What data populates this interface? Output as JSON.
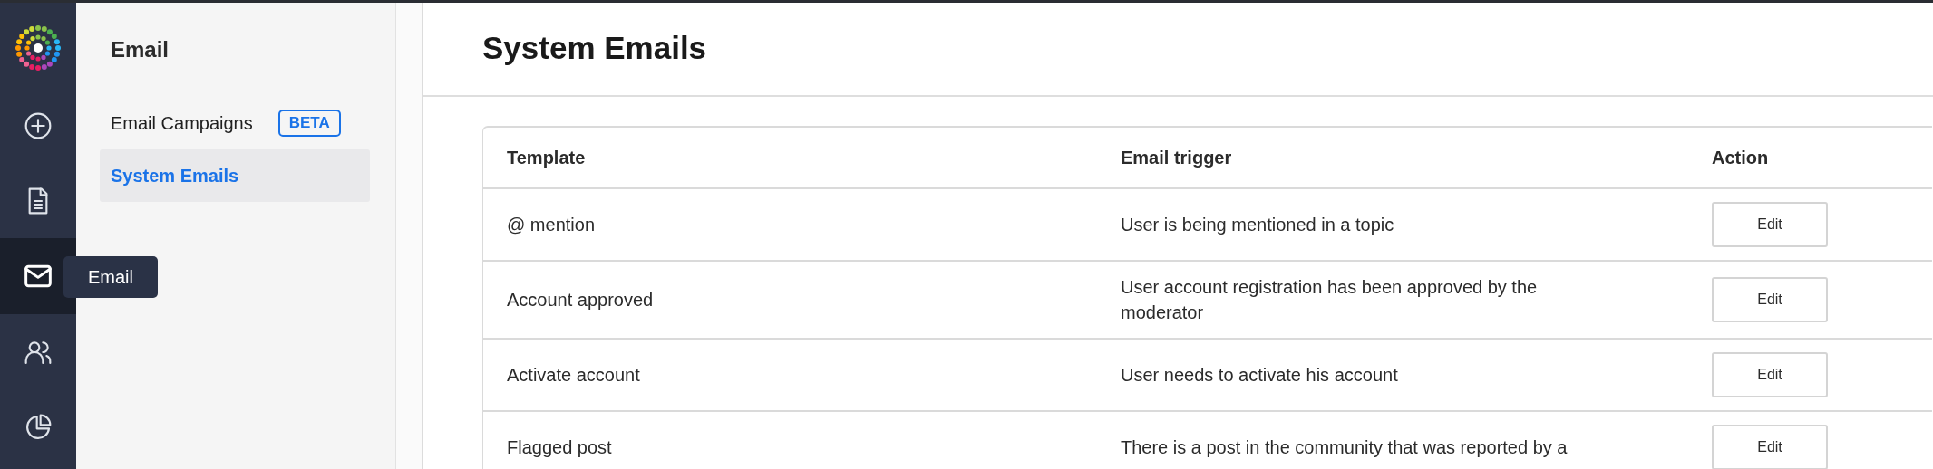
{
  "rail": {
    "items": [
      {
        "kind": "add",
        "selected": false
      },
      {
        "kind": "document",
        "selected": false
      },
      {
        "kind": "mail",
        "selected": true
      },
      {
        "kind": "people",
        "selected": false
      },
      {
        "kind": "chart",
        "selected": false
      }
    ]
  },
  "tooltip": {
    "text": "Email"
  },
  "sidebar": {
    "title": "Email",
    "items": [
      {
        "label": "Email Campaigns",
        "badge": "BETA",
        "selected": false
      },
      {
        "label": "System Emails",
        "selected": true
      }
    ]
  },
  "page": {
    "title": "System Emails"
  },
  "table": {
    "columns": [
      "Template",
      "Email trigger",
      "Action"
    ],
    "rows": [
      {
        "template": "@ mention",
        "trigger": "User is being mentioned in a topic",
        "action": "Edit"
      },
      {
        "template": "Account approved",
        "trigger": "User account registration has been approved by the moderator",
        "action": "Edit"
      },
      {
        "template": "Activate account",
        "trigger": "User needs to activate his account",
        "action": "Edit"
      },
      {
        "template": "Flagged post",
        "trigger": "There is a post in the community that was reported by a",
        "action": "Edit"
      }
    ]
  }
}
